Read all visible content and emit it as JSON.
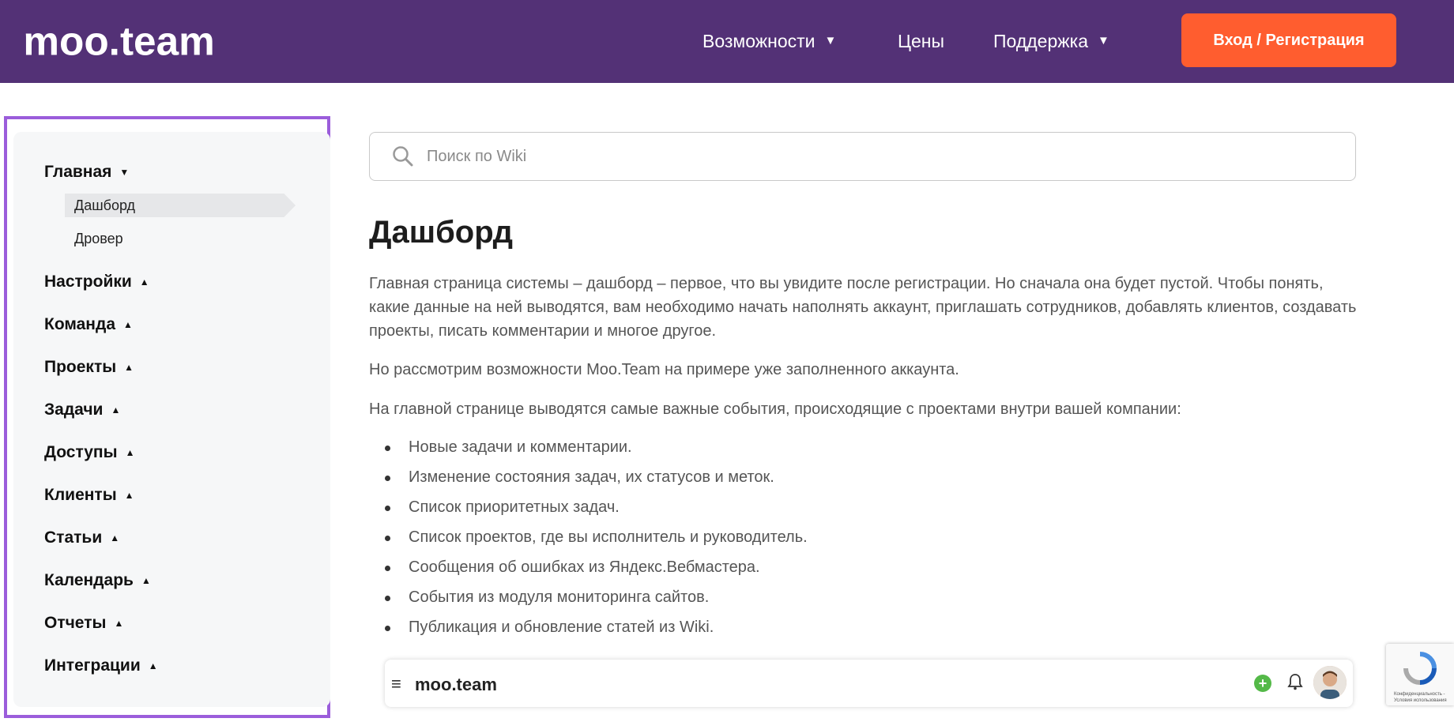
{
  "header": {
    "logo_text": "moo.team",
    "nav": [
      {
        "label": "Возможности",
        "has_dropdown": true
      },
      {
        "label": "Цены",
        "has_dropdown": false
      },
      {
        "label": "Поддержка",
        "has_dropdown": true
      }
    ],
    "login_label": "Вход / Регистрация"
  },
  "sidebar": {
    "sections": [
      {
        "label": "Главная",
        "expanded": true
      },
      {
        "label": "Настройки"
      },
      {
        "label": "Команда"
      },
      {
        "label": "Проекты"
      },
      {
        "label": "Задачи"
      },
      {
        "label": "Доступы"
      },
      {
        "label": "Клиенты"
      },
      {
        "label": "Статьи"
      },
      {
        "label": "Календарь"
      },
      {
        "label": "Отчеты"
      },
      {
        "label": "Интеграции"
      }
    ],
    "sub_items": [
      {
        "label": "Дашборд",
        "active": true
      },
      {
        "label": "Дровер"
      }
    ]
  },
  "search": {
    "placeholder": "Поиск по Wiki"
  },
  "article": {
    "title": "Дашборд",
    "paragraphs": [
      "Главная страница системы – дашборд – первое, что вы увидите после регистрации. Но сначала она будет пустой. Чтобы понять, какие данные на ней выводятся, вам необходимо начать наполнять аккаунт, приглашать сотрудников, добавлять клиентов, создавать проекты, писать комментарии и многое другое.",
      "Но рассмотрим возможности Moo.Team на примере уже заполненного аккаунта.",
      "На главной странице выводятся самые важные события, происходящие с проектами внутри вашей компании:"
    ],
    "bullets": [
      "Новые задачи и комментарии.",
      "Изменение состояния задач, их статусов и меток.",
      "Список приоритетных задач.",
      "Список проектов, где вы исполнитель и руководитель.",
      "Сообщения об ошибках из Яндекс.Вебмастера.",
      "События из модуля мониторинга сайтов.",
      "Публикация и обновление статей из Wiki."
    ]
  },
  "preview": {
    "logo_text": "moo.team"
  },
  "recaptcha": {
    "text": "Конфиденциальность - Условия использования"
  },
  "colors": {
    "header_bg": "#533176",
    "accent": "#ff5d2f",
    "sidebar_frame": "#9b5ddb",
    "sidebar_bg": "#f6f7f8"
  },
  "icons": [
    "search-icon",
    "caret-down-icon",
    "triangle-up-icon",
    "menu-icon",
    "bell-icon",
    "plus-icon",
    "avatar",
    "recaptcha-icon"
  ]
}
